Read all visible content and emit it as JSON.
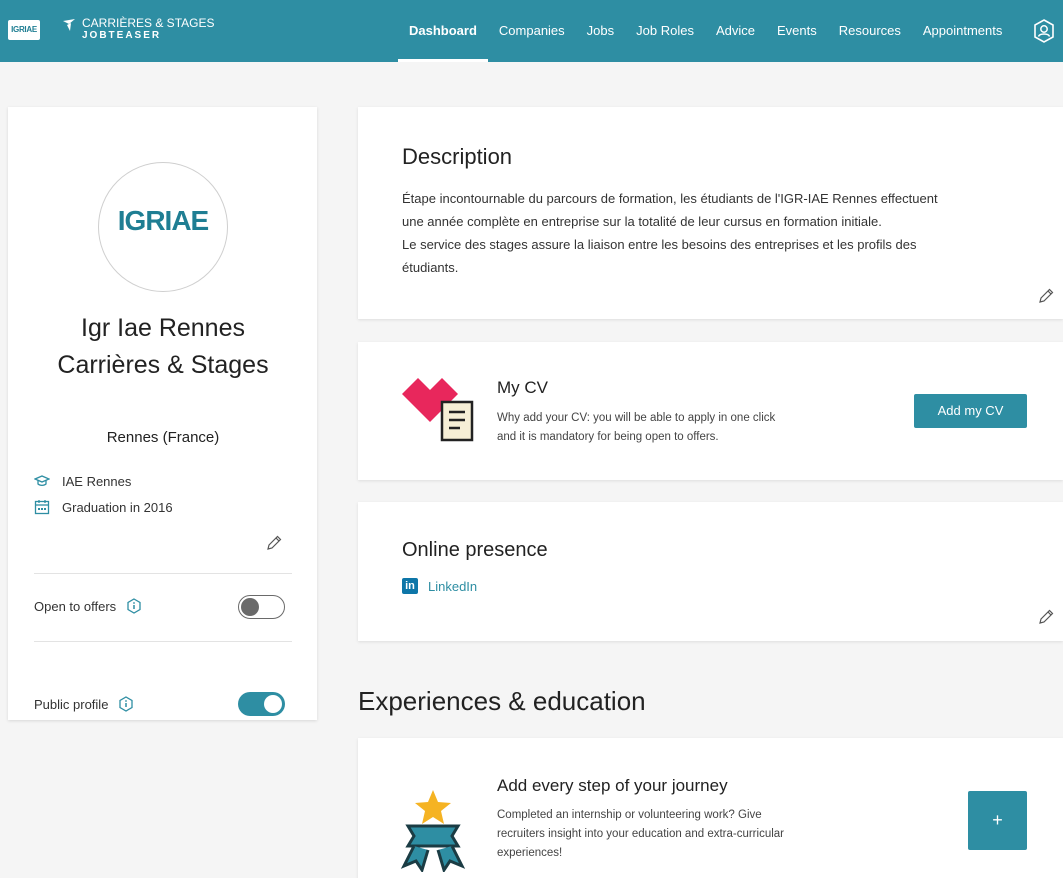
{
  "header": {
    "logo_text": "IGRIAE",
    "brand_line1": "CARRIÈRES & STAGES",
    "brand_line2": "JOBTEASER",
    "nav": [
      {
        "label": "Dashboard",
        "active": true
      },
      {
        "label": "Companies"
      },
      {
        "label": "Jobs"
      },
      {
        "label": "Job Roles"
      },
      {
        "label": "Advice"
      },
      {
        "label": "Events"
      },
      {
        "label": "Resources"
      },
      {
        "label": "Appointments"
      }
    ],
    "accent_color": "#2e8ea3"
  },
  "profile": {
    "avatar_text": "IGRIAE",
    "name": "Igr Iae Rennes Carrières & Stages",
    "location": "Rennes (France)",
    "school": "IAE Rennes",
    "graduation": "Graduation in 2016",
    "open_to_offers": {
      "label": "Open to offers",
      "enabled": false
    },
    "public_profile": {
      "label": "Public profile",
      "enabled": true
    }
  },
  "description": {
    "title": "Description",
    "body_line1": "Étape incontournable du parcours de formation, les étudiants de l'IGR-IAE Rennes effectuent",
    "body_line2": "une année complète en entreprise sur la totalité de leur cursus en formation initiale.",
    "body_line3": "Le service des stages assure la liaison entre les besoins des entreprises et les profils des",
    "body_line4": "étudiants."
  },
  "cv": {
    "title": "My CV",
    "text_line1": "Why add your CV: you will be able to apply in one click",
    "text_line2": "and it is mandatory for being open to offers.",
    "button": "Add my CV"
  },
  "online": {
    "title": "Online presence",
    "linkedin_icon": "in",
    "linkedin_label": "LinkedIn"
  },
  "experiences": {
    "heading": "Experiences & education",
    "card_title": "Add every step of your journey",
    "text_line1": "Completed an internship or volunteering work? Give",
    "text_line2": "recruiters insight into your education and extra-curricular",
    "text_line3": "experiences!",
    "add_button": "+"
  }
}
